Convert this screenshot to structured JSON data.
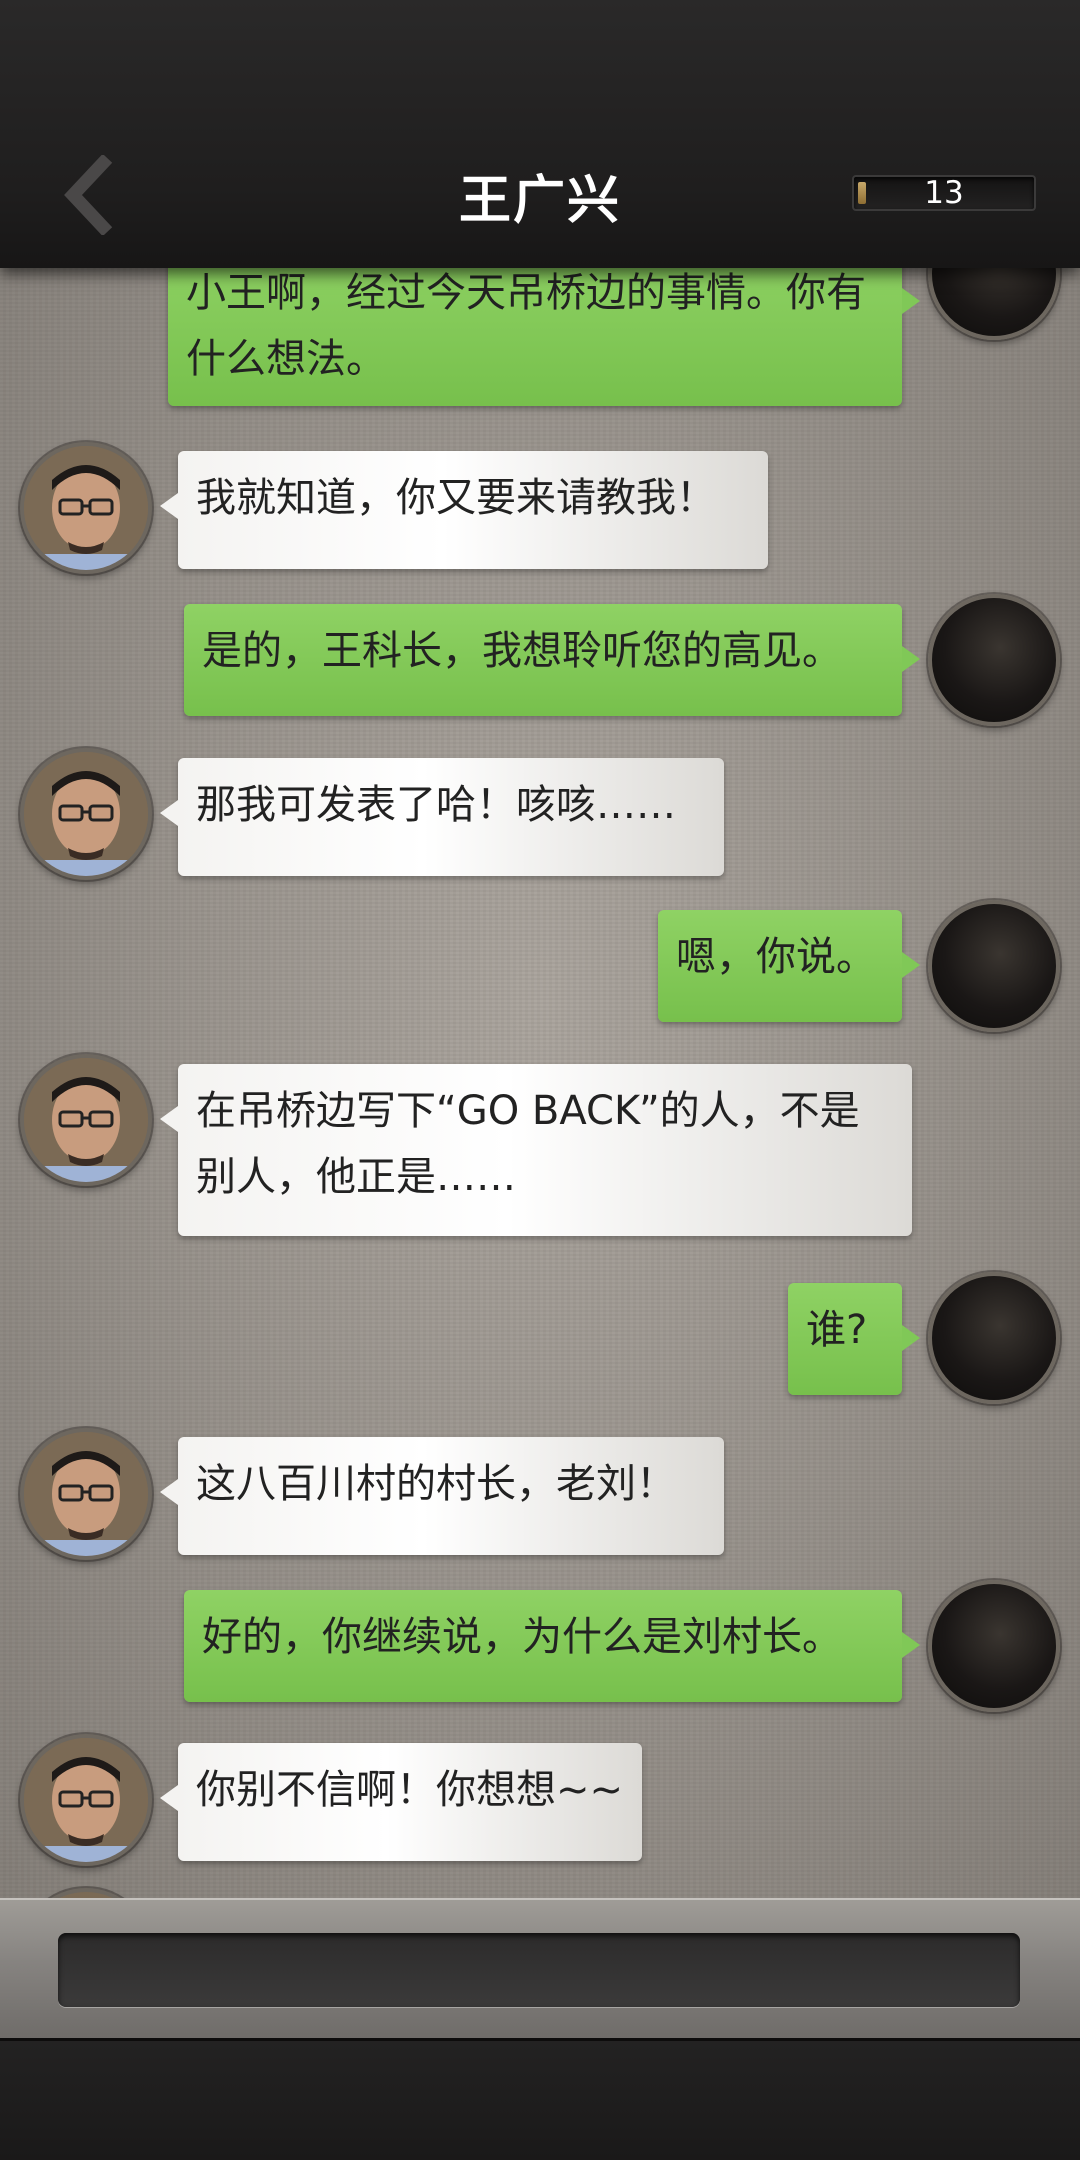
{
  "header": {
    "title": "王广兴",
    "counter": "13"
  },
  "messages": [
    {
      "from": "player",
      "text": "小王啊，经过今天吊桥边的事情。你有什么想法。"
    },
    {
      "from": "contact",
      "text": "我就知道，你又要来请教我！"
    },
    {
      "from": "player",
      "text": "是的，王科长，我想聆听您的高见。"
    },
    {
      "from": "contact",
      "text": "那我可发表了哈！咳咳……"
    },
    {
      "from": "player",
      "text": "嗯，你说。"
    },
    {
      "from": "contact",
      "text": "在吊桥边写下“GO BACK”的人，不是别人，他正是……"
    },
    {
      "from": "player",
      "text": "谁?"
    },
    {
      "from": "contact",
      "text": "这八百川村的村长，老刘！"
    },
    {
      "from": "player",
      "text": "好的，你继续说，为什么是刘村长。"
    },
    {
      "from": "contact",
      "text": "你别不信啊！你想想~~"
    }
  ],
  "colors": {
    "outgoing_bubble": "#80c857",
    "incoming_bubble": "#f4f3f1",
    "header_bg": "#222121"
  },
  "icons": {
    "back": "chevron-left-icon"
  }
}
